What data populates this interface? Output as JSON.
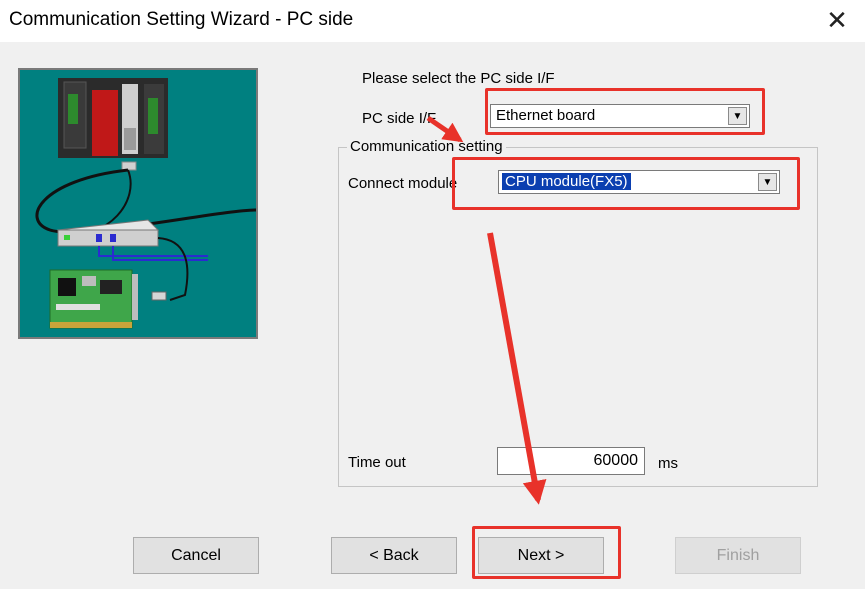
{
  "window": {
    "title": "Communication Setting Wizard - PC side",
    "close_symbol": "✕"
  },
  "pc_side": {
    "prompt": "Please select the PC side I/F",
    "label": "PC side I/F",
    "selected": "Ethernet board"
  },
  "communication_setting": {
    "group_title": "Communication setting",
    "connect_module_label": "Connect module",
    "connect_module_selected": "CPU module(FX5)",
    "timeout_label": "Time out",
    "timeout_value": "60000",
    "timeout_unit": "ms"
  },
  "buttons": {
    "cancel": "Cancel",
    "back": "< Back",
    "next": "Next >",
    "finish": "Finish"
  },
  "colors": {
    "annotation": "#e8322a",
    "illustration_bg": "#008080",
    "selection": "#0b3fb0"
  }
}
